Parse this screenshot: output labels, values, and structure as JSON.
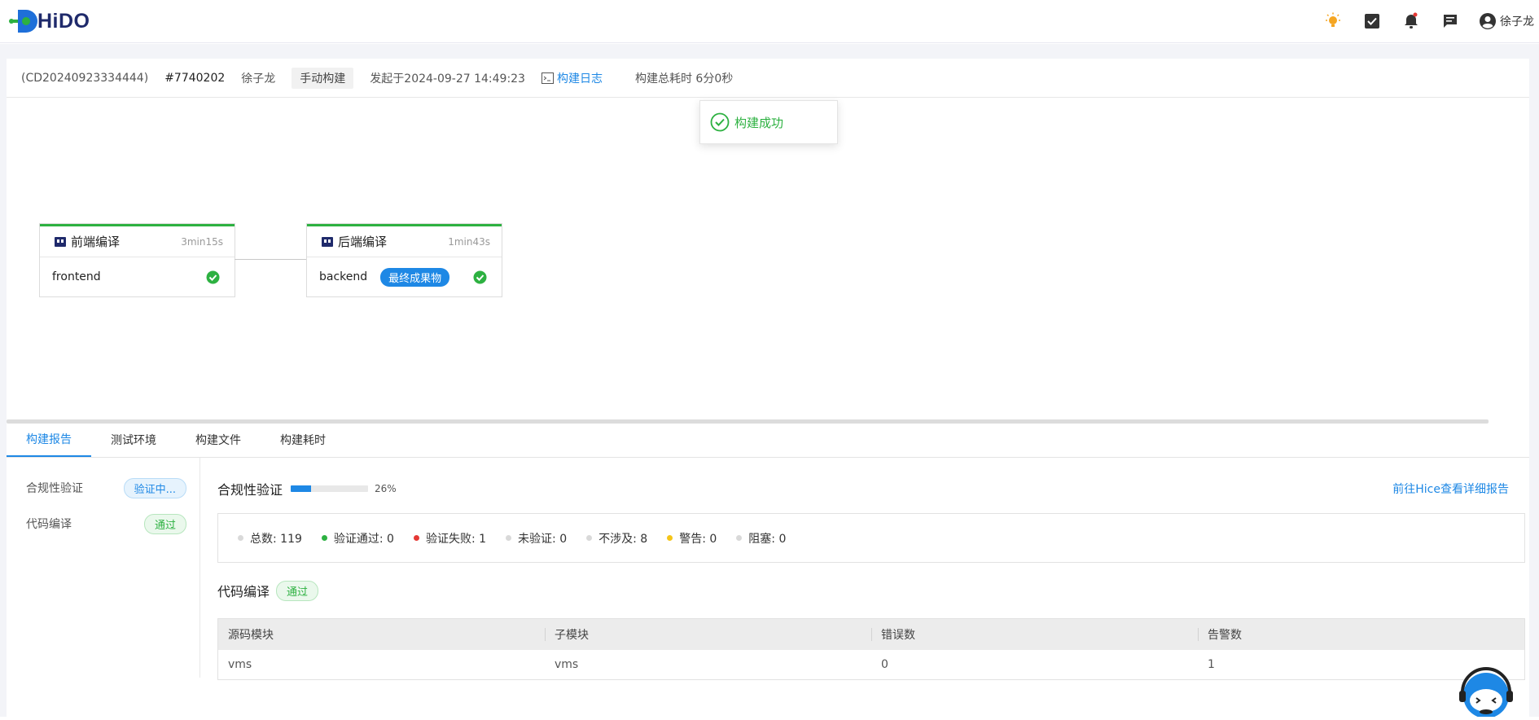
{
  "app": {
    "logo_text": "HiDO",
    "username": "徐子龙"
  },
  "header_icons": [
    "theme-bulb-icon",
    "task-check-icon",
    "notification-bell-icon",
    "message-icon",
    "user-avatar-icon"
  ],
  "build_info": {
    "code": "(CD20240923334444)",
    "number": "#7740202",
    "user": "徐子龙",
    "trigger": "手动构建",
    "started": "发起于2024-09-27 14:49:23",
    "log_link": "构建日志",
    "total_time": "构建总耗时 6分0秒"
  },
  "toast": {
    "message": "构建成功",
    "color": "#2db141"
  },
  "stages": [
    {
      "title": "前端编译",
      "duration": "3min15s",
      "job": "frontend",
      "status": "success"
    },
    {
      "title": "后端编译",
      "duration": "1min43s",
      "job": "backend",
      "badge": "最终成果物",
      "status": "success"
    }
  ],
  "tabs": [
    {
      "label": "构建报告",
      "active": true
    },
    {
      "label": "测试环境",
      "active": false
    },
    {
      "label": "构建文件",
      "active": false
    },
    {
      "label": "构建耗时",
      "active": false
    }
  ],
  "side_items": [
    {
      "label": "合规性验证",
      "status": "验证中..."
    },
    {
      "label": "代码编译",
      "status": "通过"
    }
  ],
  "compliance": {
    "title": "合规性验证",
    "progress": 26,
    "progress_text": "26%",
    "link": "前往Hice查看详细报告",
    "stats": [
      {
        "label": "总数: 119",
        "color": "#d9d9d9"
      },
      {
        "label": "验证通过: 0",
        "color": "#2db141"
      },
      {
        "label": "验证失败: 1",
        "color": "#e53935"
      },
      {
        "label": "未验证: 0",
        "color": "#d9d9d9"
      },
      {
        "label": "不涉及: 8",
        "color": "#d9d9d9"
      },
      {
        "label": "警告: 0",
        "color": "#f5c518"
      },
      {
        "label": "阻塞: 0",
        "color": "#d9d9d9"
      }
    ]
  },
  "compile": {
    "title": "代码编译",
    "status": "通过",
    "columns": [
      "源码模块",
      "子模块",
      "错误数",
      "告警数"
    ],
    "rows": [
      [
        "vms",
        "vms",
        "0",
        "1"
      ]
    ]
  },
  "colors": {
    "accent": "#1e88e5",
    "success": "#2db141",
    "error": "#e53935",
    "warning": "#f5c518"
  }
}
